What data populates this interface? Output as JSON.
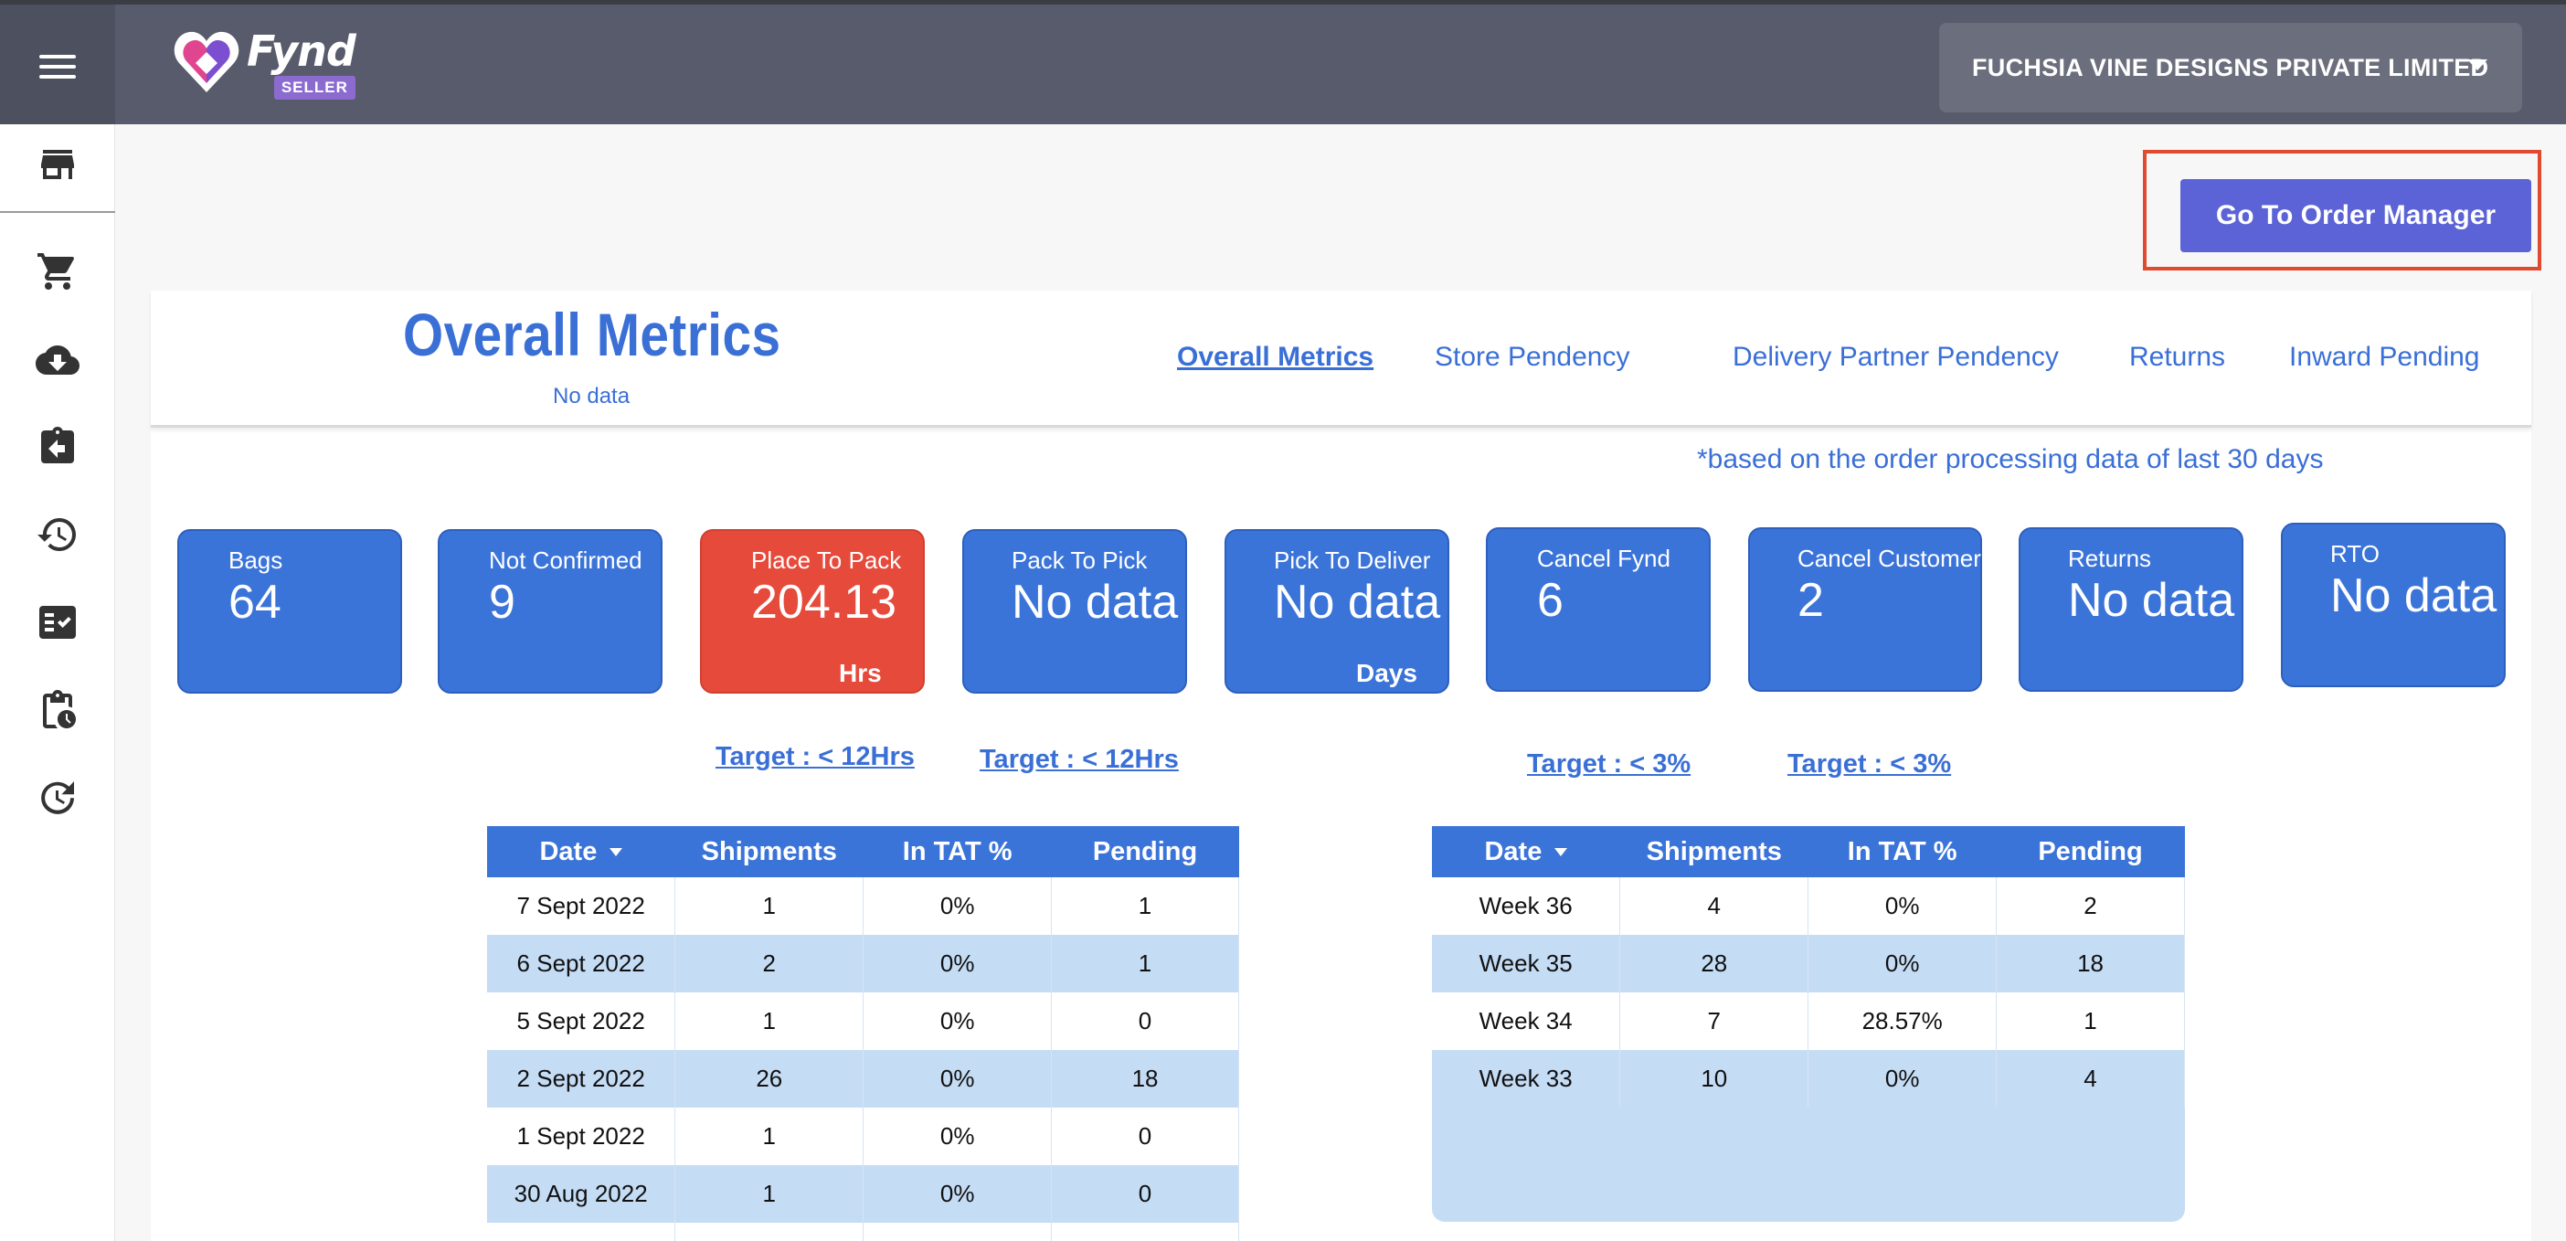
{
  "app": {
    "logo_word": "Fynd",
    "logo_badge": "SELLER"
  },
  "header": {
    "company": "FUCHSIA VINE DESIGNS PRIVATE LIMITED"
  },
  "sidebar": {
    "items": [
      {
        "icon": "store-icon"
      },
      {
        "icon": "cart-icon"
      },
      {
        "icon": "cloud-download-icon"
      },
      {
        "icon": "returns-icon"
      },
      {
        "icon": "history-icon"
      },
      {
        "icon": "checklist-icon"
      },
      {
        "icon": "clipboard-clock-icon"
      },
      {
        "icon": "refresh-history-icon"
      }
    ]
  },
  "actions": {
    "order_manager": "Go To Order Manager"
  },
  "panel": {
    "title": "Overall Metrics",
    "subtitle": "No data",
    "tabs": [
      "Overall Metrics",
      "Store Pendency",
      "Delivery Partner Pendency",
      "Returns",
      "Inward Pending"
    ],
    "active_tab": "Overall Metrics",
    "note": "*based on the order processing data of last 30 days"
  },
  "metrics": [
    {
      "label": "Bags",
      "value": "64",
      "unit": "",
      "status": "normal"
    },
    {
      "label": "Not Confirmed",
      "value": "9",
      "unit": "",
      "status": "normal"
    },
    {
      "label": "Place To Pack",
      "value": "204.13",
      "unit": "Hrs",
      "status": "alert"
    },
    {
      "label": "Pack To Pick",
      "value": "No data",
      "unit": "",
      "status": "normal"
    },
    {
      "label": "Pick To Deliver",
      "value": "No data",
      "unit": "Days",
      "status": "normal"
    },
    {
      "label": "Cancel Fynd",
      "value": "6",
      "unit": "",
      "status": "normal"
    },
    {
      "label": "Cancel Customer",
      "value": "2",
      "unit": "",
      "status": "normal"
    },
    {
      "label": "Returns",
      "value": "No data",
      "unit": "",
      "status": "normal"
    },
    {
      "label": "RTO",
      "value": "No data",
      "unit": "",
      "status": "normal"
    }
  ],
  "targets": [
    "Target : < 12Hrs",
    "Target : < 12Hrs",
    "Target : < 3%",
    "Target : < 3%"
  ],
  "colors": {
    "accent": "#3b74d9",
    "alert": "#e64a3b",
    "button": "#5b63d6",
    "highlight": "#e04a2e",
    "row_alt": "#c5dcf5"
  },
  "daily_table": {
    "columns": [
      "Date",
      "Shipments",
      "In TAT %",
      "Pending"
    ],
    "rows": [
      [
        "7 Sept 2022",
        "1",
        "0%",
        "1"
      ],
      [
        "6 Sept 2022",
        "2",
        "0%",
        "1"
      ],
      [
        "5 Sept 2022",
        "1",
        "0%",
        "0"
      ],
      [
        "2 Sept 2022",
        "26",
        "0%",
        "18"
      ],
      [
        "1 Sept 2022",
        "1",
        "0%",
        "0"
      ],
      [
        "30 Aug 2022",
        "1",
        "0%",
        "0"
      ]
    ]
  },
  "weekly_table": {
    "columns": [
      "Date",
      "Shipments",
      "In TAT %",
      "Pending"
    ],
    "rows": [
      [
        "Week 36",
        "4",
        "0%",
        "2"
      ],
      [
        "Week 35",
        "28",
        "0%",
        "18"
      ],
      [
        "Week 34",
        "7",
        "28.57%",
        "1"
      ],
      [
        "Week 33",
        "10",
        "0%",
        "4"
      ]
    ]
  }
}
